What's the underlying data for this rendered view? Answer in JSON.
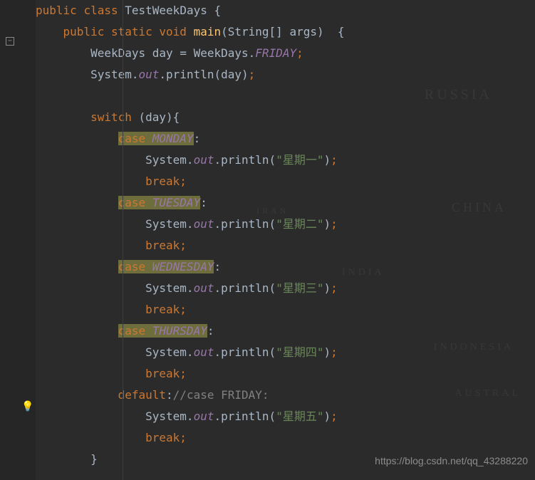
{
  "watermark": "https://blog.csdn.net/qq_43288220",
  "bg": {
    "t1": "RUSSIA",
    "t2": "CHINA",
    "t3": "IRAN",
    "t4": "INDIA",
    "t5": "INDONESIA",
    "t6": "AUSTRAL"
  },
  "code": {
    "l1": {
      "public": "public",
      "class": "class",
      "name": "TestWeekDays",
      "brace": "{"
    },
    "l2": {
      "public": "public",
      "static": "static",
      "void": "void",
      "main": "main",
      "args": "(String[] args)  {"
    },
    "l3": {
      "type": "WeekDays",
      "var": "day",
      "eq": "=",
      "enum": "WeekDays.",
      "val": "FRIDAY",
      "semi": ";"
    },
    "l4": {
      "sys": "System.",
      "out": "out",
      "dot": ".",
      "pr": "println",
      "open": "(",
      "arg": "day",
      "close": ")",
      "semi": ";"
    },
    "l6": {
      "sw": "switch",
      "open": " (",
      "var": "day",
      "close": "){"
    },
    "c1": {
      "case": "case",
      "val": "MONDAY",
      "colon": ":"
    },
    "p1": {
      "sys": "System.",
      "out": "out",
      "dot": ".",
      "pr": "println",
      "open": "(",
      "str": "\"星期一\"",
      "close": ")",
      "semi": ";"
    },
    "b1": {
      "brk": "break",
      "semi": ";"
    },
    "c2": {
      "case": "case",
      "val": "TUESDAY",
      "colon": ":"
    },
    "p2": {
      "sys": "System.",
      "out": "out",
      "dot": ".",
      "pr": "println",
      "open": "(",
      "str": "\"星期二\"",
      "close": ")",
      "semi": ";"
    },
    "b2": {
      "brk": "break",
      "semi": ";"
    },
    "c3": {
      "case": "case",
      "val": "WEDNESDAY",
      "colon": ":"
    },
    "p3": {
      "sys": "System.",
      "out": "out",
      "dot": ".",
      "pr": "println",
      "open": "(",
      "str": "\"星期三\"",
      "close": ")",
      "semi": ";"
    },
    "b3": {
      "brk": "break",
      "semi": ";"
    },
    "c4": {
      "case": "case",
      "val": "THURSDAY",
      "colon": ":"
    },
    "p4": {
      "sys": "System.",
      "out": "out",
      "dot": ".",
      "pr": "println",
      "open": "(",
      "str": "\"星期四\"",
      "close": ")",
      "semi": ";"
    },
    "b4": {
      "brk": "break",
      "semi": ";"
    },
    "df": {
      "default": "default",
      "colon": ":",
      "comment": "//case FRIDAY:"
    },
    "p5": {
      "sys": "System.",
      "out": "out",
      "dot": ".",
      "pr": "println",
      "open": "(",
      "str": "\"星期五\"",
      "close": ")",
      "semi": ";"
    },
    "b5": {
      "brk": "break",
      "semi": ";"
    },
    "end": {
      "brace": "}"
    }
  }
}
